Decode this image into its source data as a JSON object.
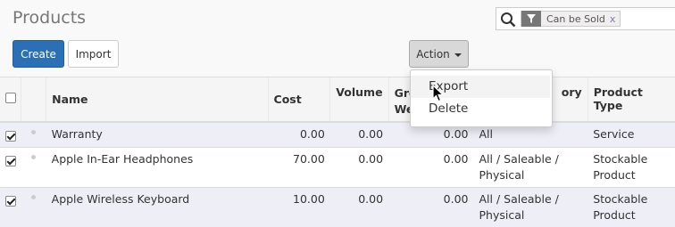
{
  "page": {
    "title": "Products"
  },
  "search": {
    "facet_label": "Can be Sold",
    "facet_remove": "x",
    "icons": {
      "search": "search-icon",
      "facet": "filter-icon"
    }
  },
  "buttons": {
    "create": "Create",
    "import": "Import",
    "action": "Action"
  },
  "action_menu": {
    "items": [
      "Export",
      "Delete"
    ],
    "hovered": "Export"
  },
  "table": {
    "columns": [
      "Name",
      "Cost",
      "Volume",
      "Gro\nWe",
      "ory",
      "Product Type"
    ],
    "rows": [
      {
        "checked": true,
        "name": "Warranty",
        "cost": "0.00",
        "volume": "0.00",
        "weight": "0.00",
        "category": "All",
        "type": "Service"
      },
      {
        "checked": true,
        "name": "Apple In-Ear Headphones",
        "cost": "70.00",
        "volume": "0.00",
        "weight": "0.00",
        "category": "All / Saleable /\nPhysical",
        "type": "Stockable\nProduct"
      },
      {
        "checked": true,
        "name": "Apple Wireless Keyboard",
        "cost": "10.00",
        "volume": "0.00",
        "weight": "0.00",
        "category": "All / Saleable /\nPhysical",
        "type": "Stockable\nProduct"
      }
    ]
  },
  "colors": {
    "primary": "#2b6fb6",
    "row_highlight": "#eeeef6"
  }
}
